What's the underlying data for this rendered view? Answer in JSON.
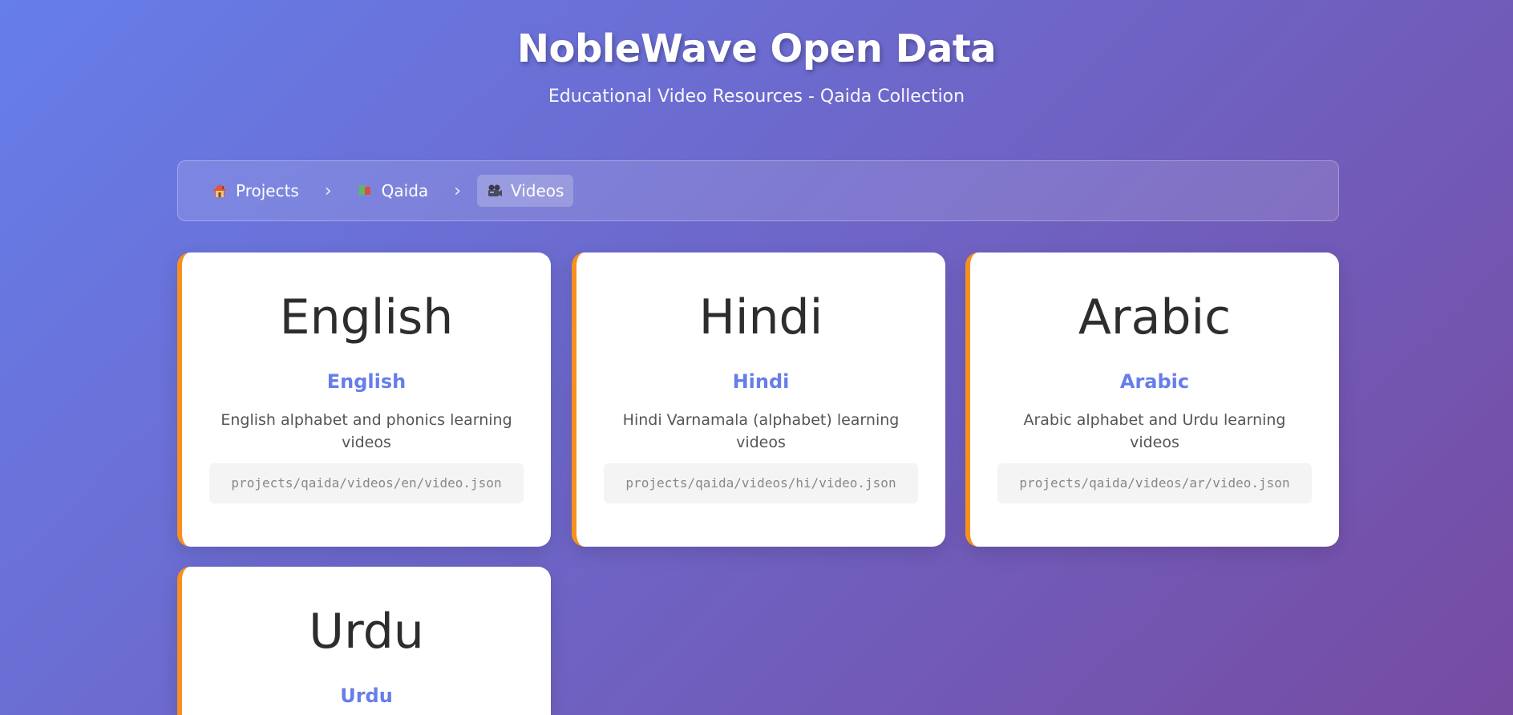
{
  "header": {
    "title": "NobleWave Open Data",
    "subtitle": "Educational Video Resources - Qaida Collection"
  },
  "breadcrumb": {
    "separator": "›",
    "items": [
      {
        "label": "Projects",
        "icon": "house-icon",
        "active": false
      },
      {
        "label": "Qaida",
        "icon": "books-icon",
        "active": false
      },
      {
        "label": "Videos",
        "icon": "video-camera-icon",
        "active": true
      }
    ]
  },
  "colors": {
    "accent": "#667eea",
    "card_border": "#f6901e",
    "background_start": "#667eea",
    "background_end": "#764ba2"
  },
  "cards": [
    {
      "native": "English",
      "name": "English",
      "description": "English alphabet and phonics learning videos",
      "path": "projects/qaida/videos/en/video.json"
    },
    {
      "native": "Hindi",
      "name": "Hindi",
      "description": "Hindi Varnamala (alphabet) learning videos",
      "path": "projects/qaida/videos/hi/video.json"
    },
    {
      "native": "Arabic",
      "name": "Arabic",
      "description": "Arabic alphabet and Urdu learning videos",
      "path": "projects/qaida/videos/ar/video.json"
    },
    {
      "native": "Urdu",
      "name": "Urdu"
    }
  ]
}
